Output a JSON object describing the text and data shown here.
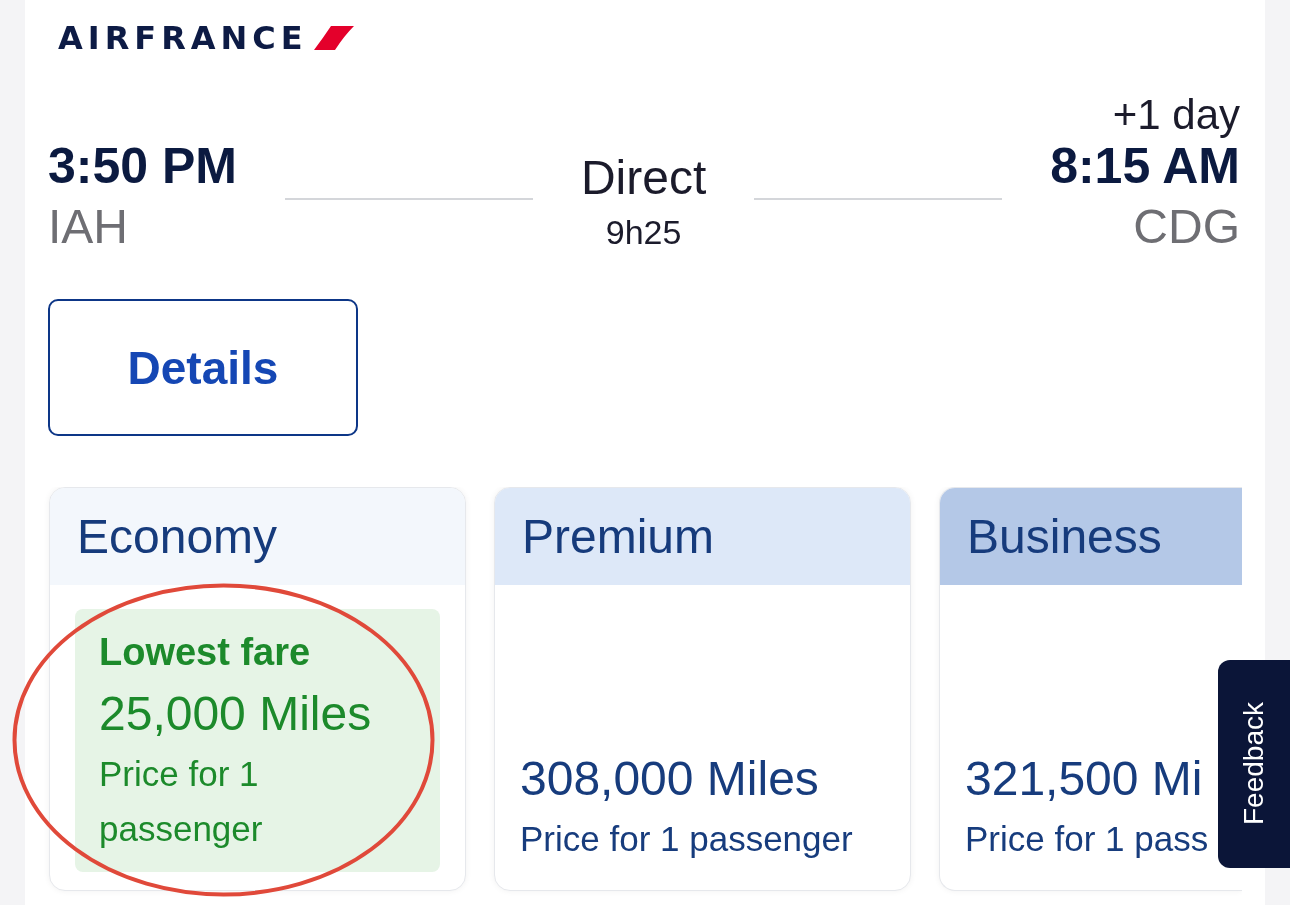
{
  "logo": {
    "text": "AIRFRANCE"
  },
  "flight": {
    "departure": {
      "time": "3:50 PM",
      "airport": "IAH"
    },
    "stops": "Direct",
    "duration": "9h25",
    "arrival": {
      "day_offset": "+1 day",
      "time": "8:15 AM",
      "airport": "CDG"
    }
  },
  "details_button": "Details",
  "fares": [
    {
      "cabin": "Economy",
      "color": "#f3f7fc",
      "lowest": true,
      "circled": true,
      "tag": "Lowest fare",
      "price": "25,000 Miles",
      "note": "Price for 1 passenger"
    },
    {
      "cabin": "Premium",
      "color": "#dde8f8",
      "lowest": false,
      "circled": false,
      "price": "308,000 Miles",
      "note": "Price for 1 passenger"
    },
    {
      "cabin": "Business",
      "color": "#b4c8e7",
      "lowest": false,
      "circled": false,
      "price": "321,500 Mi",
      "note": "Price for 1 pass"
    }
  ],
  "feedback_tab": "Feedback"
}
